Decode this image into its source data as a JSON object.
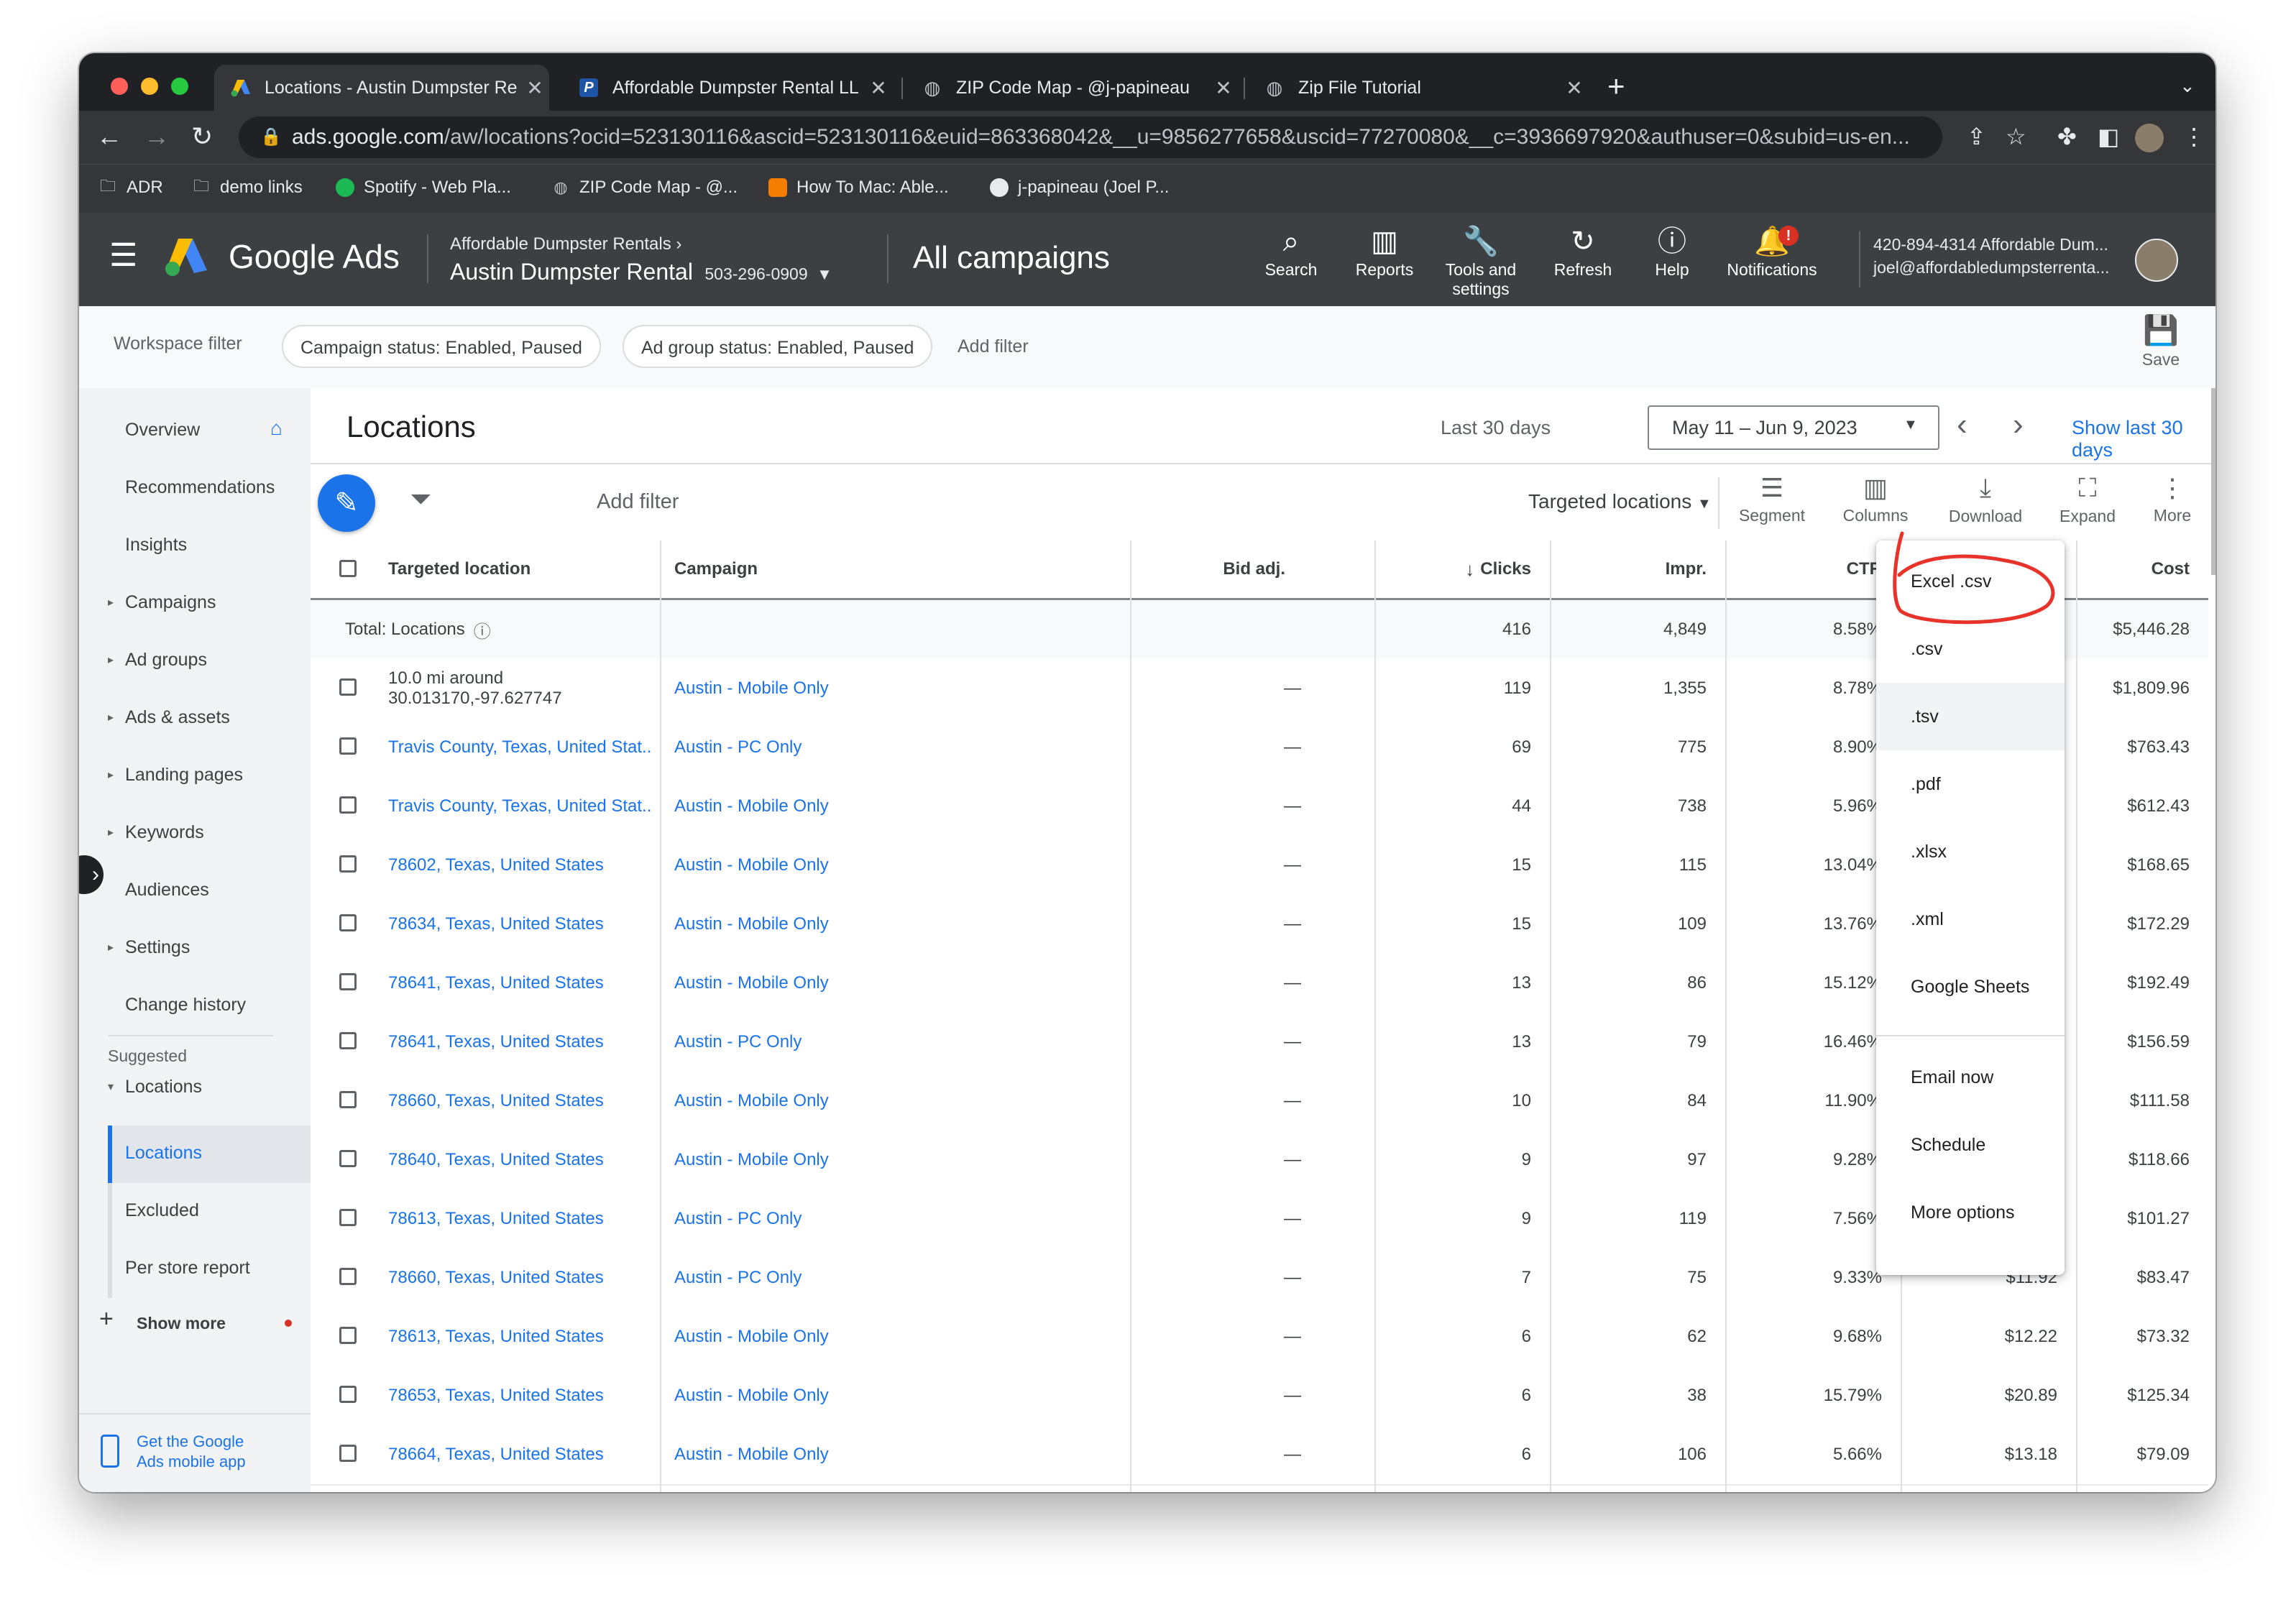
{
  "browser": {
    "tabs": [
      {
        "title": "Locations - Austin Dumpster Re",
        "active": true
      },
      {
        "title": "Affordable Dumpster Rental LL",
        "active": false
      },
      {
        "title": "ZIP Code Map - @j-papineau",
        "active": false
      },
      {
        "title": "Zip File Tutorial",
        "active": false
      }
    ],
    "url_host": "ads.google.com",
    "url_path": "/aw/locations?ocid=523130116&ascid=523130116&euid=863368042&__u=9856277658&uscid=77270080&__c=3936697920&authuser=0&subid=us-en...",
    "bookmarks": [
      "ADR",
      "demo links",
      "Spotify - Web Pla...",
      "ZIP Code Map - @...",
      "How To Mac: Able...",
      "j-papineau (Joel P..."
    ]
  },
  "header": {
    "logo_text": "Google Ads",
    "account_parent": "Affordable Dumpster Rentals",
    "account_name": "Austin Dumpster Rental",
    "account_phone": "503-296-0909",
    "scope": "All campaigns",
    "buttons": {
      "search": "Search",
      "reports": "Reports",
      "tools_line1": "Tools and",
      "tools_line2": "settings",
      "refresh": "Refresh",
      "help": "Help",
      "notifications": "Notifications"
    },
    "notification_badge": "!",
    "user_line1": "420-894-4314 Affordable Dum...",
    "user_line2": "joel@affordabledumpsterrenta..."
  },
  "filterbar": {
    "label": "Workspace filter",
    "chips": [
      "Campaign status: Enabled, Paused",
      "Ad group status: Enabled, Paused"
    ],
    "add_filter": "Add filter",
    "save": "Save"
  },
  "sidebar": {
    "items": [
      "Overview",
      "Recommendations",
      "Insights",
      "Campaigns",
      "Ad groups",
      "Ads & assets",
      "Landing pages",
      "Keywords",
      "Audiences",
      "Settings",
      "Change history"
    ],
    "suggested_label": "Suggested",
    "locations_parent": "Locations",
    "sub_items": [
      "Locations",
      "Excluded",
      "Per store report"
    ],
    "show_more": "Show more",
    "mobile_line1": "Get the Google",
    "mobile_line2": "Ads mobile app"
  },
  "page": {
    "title": "Locations",
    "date_label": "Last 30 days",
    "date_range": "May 11 – Jun 9, 2023",
    "show_last": "Show last 30 days",
    "add_filter": "Add filter",
    "view_select": "Targeted locations",
    "tools": {
      "segment": "Segment",
      "columns": "Columns",
      "download": "Download",
      "expand": "Expand",
      "more": "More"
    }
  },
  "table": {
    "headers": {
      "location": "Targeted location",
      "campaign": "Campaign",
      "bid": "Bid adj.",
      "clicks": "Clicks",
      "impr": "Impr.",
      "ctr": "CTR",
      "cost": "Cost"
    },
    "total": {
      "label": "Total: Locations",
      "clicks": "416",
      "impr": "4,849",
      "ctr": "8.58%",
      "cost": "$5,446.28"
    },
    "rows": [
      {
        "loc1": "10.0 mi around",
        "loc2": "30.013170,-97.627747",
        "campaign": "Austin - Mobile Only",
        "bid": "—",
        "clicks": "119",
        "impr": "1,355",
        "ctr": "8.78%",
        "cpc": "",
        "cost": "$1,809.96"
      },
      {
        "loc1": "Travis County, Texas, United Stat...",
        "loc2": "",
        "campaign": "Austin - PC Only",
        "bid": "—",
        "clicks": "69",
        "impr": "775",
        "ctr": "8.90%",
        "cpc": "",
        "cost": "$763.43"
      },
      {
        "loc1": "Travis County, Texas, United Stat...",
        "loc2": "",
        "campaign": "Austin - Mobile Only",
        "bid": "—",
        "clicks": "44",
        "impr": "738",
        "ctr": "5.96%",
        "cpc": "",
        "cost": "$612.43"
      },
      {
        "loc1": "78602, Texas, United States",
        "loc2": "",
        "campaign": "Austin - Mobile Only",
        "bid": "—",
        "clicks": "15",
        "impr": "115",
        "ctr": "13.04%",
        "cpc": "",
        "cost": "$168.65"
      },
      {
        "loc1": "78634, Texas, United States",
        "loc2": "",
        "campaign": "Austin - Mobile Only",
        "bid": "—",
        "clicks": "15",
        "impr": "109",
        "ctr": "13.76%",
        "cpc": "",
        "cost": "$172.29"
      },
      {
        "loc1": "78641, Texas, United States",
        "loc2": "",
        "campaign": "Austin - Mobile Only",
        "bid": "—",
        "clicks": "13",
        "impr": "86",
        "ctr": "15.12%",
        "cpc": "",
        "cost": "$192.49"
      },
      {
        "loc1": "78641, Texas, United States",
        "loc2": "",
        "campaign": "Austin - PC Only",
        "bid": "—",
        "clicks": "13",
        "impr": "79",
        "ctr": "16.46%",
        "cpc": "",
        "cost": "$156.59"
      },
      {
        "loc1": "78660, Texas, United States",
        "loc2": "",
        "campaign": "Austin - Mobile Only",
        "bid": "—",
        "clicks": "10",
        "impr": "84",
        "ctr": "11.90%",
        "cpc": "",
        "cost": "$111.58"
      },
      {
        "loc1": "78640, Texas, United States",
        "loc2": "",
        "campaign": "Austin - Mobile Only",
        "bid": "—",
        "clicks": "9",
        "impr": "97",
        "ctr": "9.28%",
        "cpc": "",
        "cost": "$118.66"
      },
      {
        "loc1": "78613, Texas, United States",
        "loc2": "",
        "campaign": "Austin - PC Only",
        "bid": "—",
        "clicks": "9",
        "impr": "119",
        "ctr": "7.56%",
        "cpc": "",
        "cost": "$101.27"
      },
      {
        "loc1": "78660, Texas, United States",
        "loc2": "",
        "campaign": "Austin - PC Only",
        "bid": "—",
        "clicks": "7",
        "impr": "75",
        "ctr": "9.33%",
        "cpc": "$11.92",
        "cost": "$83.47"
      },
      {
        "loc1": "78613, Texas, United States",
        "loc2": "",
        "campaign": "Austin - Mobile Only",
        "bid": "—",
        "clicks": "6",
        "impr": "62",
        "ctr": "9.68%",
        "cpc": "$12.22",
        "cost": "$73.32"
      },
      {
        "loc1": "78653, Texas, United States",
        "loc2": "",
        "campaign": "Austin - Mobile Only",
        "bid": "—",
        "clicks": "6",
        "impr": "38",
        "ctr": "15.79%",
        "cpc": "$20.89",
        "cost": "$125.34"
      },
      {
        "loc1": "78664, Texas, United States",
        "loc2": "",
        "campaign": "Austin - Mobile Only",
        "bid": "—",
        "clicks": "6",
        "impr": "106",
        "ctr": "5.66%",
        "cpc": "$13.18",
        "cost": "$79.09"
      }
    ]
  },
  "download_menu": {
    "items": [
      "Excel .csv",
      ".csv",
      ".tsv",
      ".pdf",
      ".xlsx",
      ".xml",
      "Google Sheets"
    ],
    "items2": [
      "Email now",
      "Schedule",
      "More options"
    ]
  },
  "colors": {
    "accent": "#1a73e8",
    "header_bg": "#3c4043",
    "annotation": "#e8332a"
  }
}
